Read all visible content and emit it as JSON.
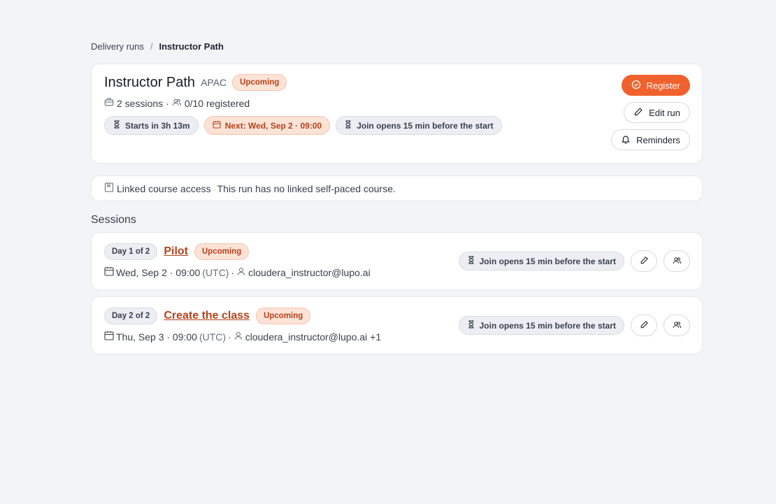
{
  "breadcrumb": {
    "parent": "Delivery runs",
    "separator": "/",
    "current": "Instructor Path"
  },
  "run": {
    "title": "Instructor Path",
    "region": "APAC",
    "status": "Upcoming",
    "sessions_count": "2 sessions",
    "dot": "·",
    "registered": "0/10 registered",
    "chips": {
      "starts_in": "Starts in 3h 13m",
      "next": "Next: Wed, Sep 2 · 09:00",
      "join": "Join opens 15 min before the start"
    }
  },
  "actions": {
    "register": "Register",
    "edit": "Edit run",
    "reminders": "Reminders"
  },
  "linked_course": {
    "label": "Linked course access",
    "message": "This run has no linked self-paced course."
  },
  "sessions_title": "Sessions",
  "sessions": [
    {
      "day": "Day 1 of 2",
      "name": "Pilot",
      "status": "Upcoming",
      "date": "Wed, Sep 2 · 09:00",
      "tz": "(UTC)",
      "sep": "·",
      "instructor": "cloudera_instructor@lupo.ai",
      "join": "Join opens 15 min before the start"
    },
    {
      "day": "Day 2 of 2",
      "name": "Create the class",
      "status": "Upcoming",
      "date": "Thu, Sep 3 · 09:00",
      "tz": "(UTC)",
      "sep": "·",
      "instructor": "cloudera_instructor@lupo.ai +1",
      "join": "Join opens 15 min before the start"
    }
  ],
  "colors": {
    "accent": "#f0612d",
    "badge_bg": "#fde3d6",
    "badge_text": "#b4421a",
    "page_bg": "#f3f4f7"
  }
}
